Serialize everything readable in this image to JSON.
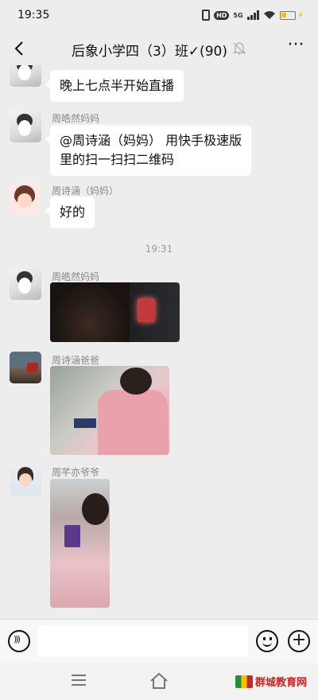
{
  "status_bar": {
    "time": "19:35",
    "network": "5G",
    "hd_badge": "HD",
    "icons": [
      "vibrate-icon",
      "hd-icon",
      "signal-icon",
      "wifi-icon",
      "battery-icon",
      "charging-icon"
    ]
  },
  "header": {
    "title": "后象小学四（3）班✓(90)",
    "back_icon": "chevron-left-icon",
    "mute_icon": "bell-off-icon",
    "more_label": "···"
  },
  "messages": [
    {
      "type": "text",
      "sender": "",
      "text": "晚上七点半开始直播",
      "avatar": "cartoon"
    },
    {
      "type": "text",
      "sender": "周皓然妈妈",
      "text": "@周诗涵（妈妈） 用快手极速版里的扫一扫扫二维码",
      "line1": "@周诗涵（妈妈） 用快手极速版",
      "line2": "里的扫一扫扫二维码",
      "avatar": "cartoon"
    },
    {
      "type": "text",
      "sender": "周诗涵（妈妈）",
      "text": "好的",
      "avatar": "girl"
    },
    {
      "type": "time",
      "text": "19:31"
    },
    {
      "type": "image",
      "sender": "周皓然妈妈",
      "avatar": "cartoon"
    },
    {
      "type": "image",
      "sender": "周诗涵爸爸",
      "avatar": "car"
    },
    {
      "type": "image",
      "sender": "周芊亦爷爷",
      "avatar": "kid"
    }
  ],
  "input_bar": {
    "placeholder": "",
    "icons": [
      "voice-icon",
      "emoji-icon",
      "plus-icon"
    ]
  },
  "nav_bar": {
    "icons": [
      "menu-icon",
      "home-icon"
    ],
    "watermark": "群城教育网"
  },
  "colors": {
    "background": "#ededed",
    "bubble": "#ffffff",
    "sender_text": "#888888",
    "watermark_red": "#d02020"
  }
}
